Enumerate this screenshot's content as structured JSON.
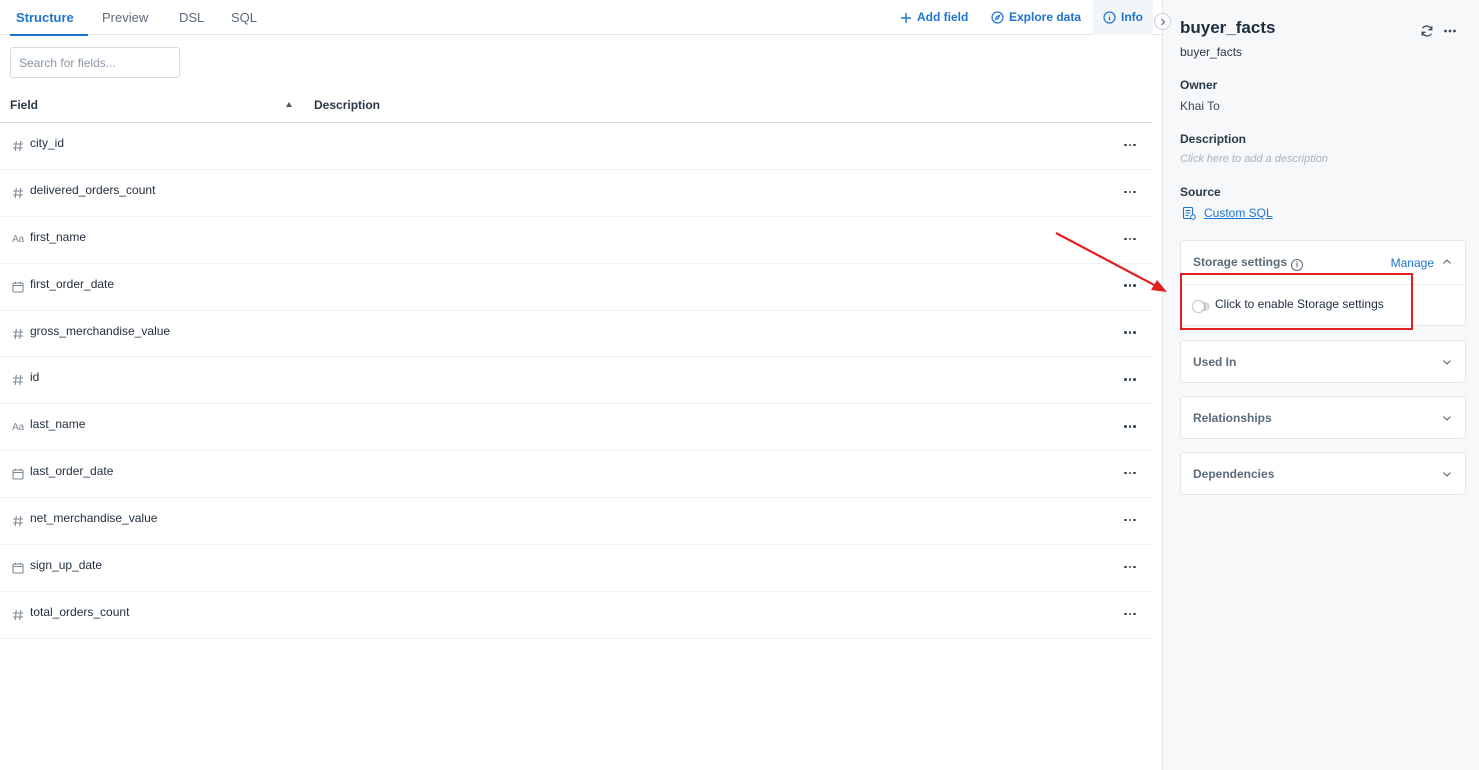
{
  "tabs": [
    {
      "label": "Structure",
      "active": true
    },
    {
      "label": "Preview",
      "active": false
    },
    {
      "label": "DSL",
      "active": false
    },
    {
      "label": "SQL",
      "active": false
    }
  ],
  "actions": {
    "add_field": "Add field",
    "explore_data": "Explore data",
    "info": "Info"
  },
  "search": {
    "placeholder": "Search for fields..."
  },
  "table": {
    "columns": {
      "field": "Field",
      "description": "Description"
    },
    "sort": "ascending",
    "rows": [
      {
        "type": "number",
        "name": "city_id"
      },
      {
        "type": "number",
        "name": "delivered_orders_count"
      },
      {
        "type": "text",
        "name": "first_name"
      },
      {
        "type": "date",
        "name": "first_order_date"
      },
      {
        "type": "number",
        "name": "gross_merchandise_value"
      },
      {
        "type": "number",
        "name": "id"
      },
      {
        "type": "text",
        "name": "last_name"
      },
      {
        "type": "date",
        "name": "last_order_date"
      },
      {
        "type": "number",
        "name": "net_merchandise_value"
      },
      {
        "type": "date",
        "name": "sign_up_date"
      },
      {
        "type": "number",
        "name": "total_orders_count"
      }
    ]
  },
  "panel": {
    "title": "buyer_facts",
    "subtitle": "buyer_facts",
    "owner_label": "Owner",
    "owner": "Khai To",
    "description_label": "Description",
    "description_placeholder": "Click here to add a description",
    "source_label": "Source",
    "source_link": "Custom SQL",
    "storage": {
      "title": "Storage settings",
      "manage": "Manage",
      "toggle_label": "Click to enable Storage settings",
      "enabled": false
    },
    "sections": [
      "Used In",
      "Relationships",
      "Dependencies"
    ]
  },
  "colors": {
    "accent": "#1e74d1",
    "annotation": "#e02020"
  }
}
